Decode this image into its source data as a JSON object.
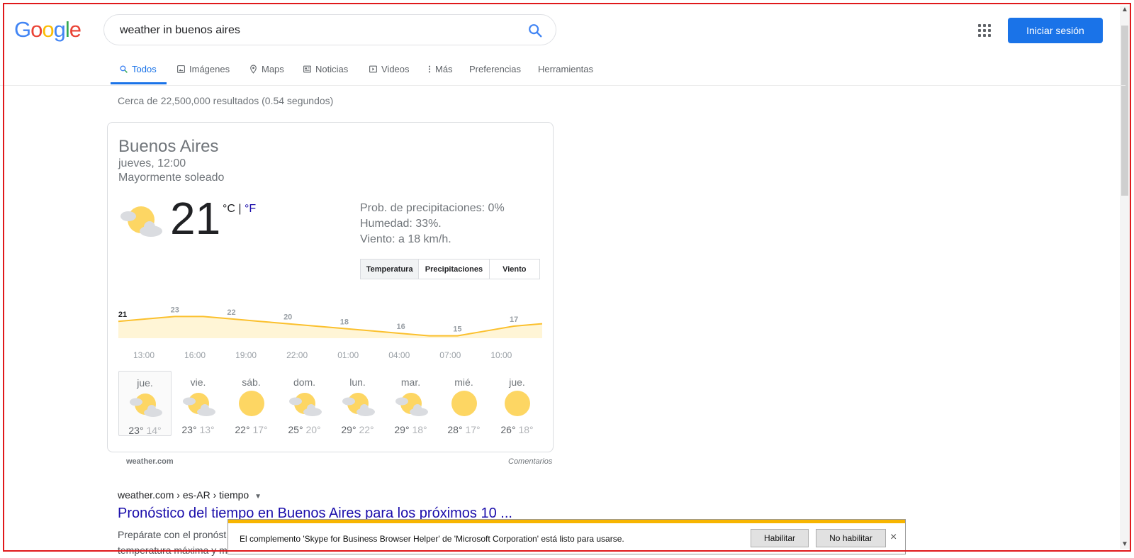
{
  "header": {
    "logo_letters": [
      {
        "ch": "G",
        "color": "#4285f4"
      },
      {
        "ch": "o",
        "color": "#ea4335"
      },
      {
        "ch": "o",
        "color": "#fbbc05"
      },
      {
        "ch": "g",
        "color": "#4285f4"
      },
      {
        "ch": "l",
        "color": "#34a853"
      },
      {
        "ch": "e",
        "color": "#ea4335"
      }
    ],
    "query": "weather in buenos aires",
    "signin_label": "Iniciar sesión"
  },
  "tabs": [
    {
      "label": "Todos",
      "icon": "search-icon",
      "active": true
    },
    {
      "label": "Imágenes",
      "icon": "image-icon"
    },
    {
      "label": "Maps",
      "icon": "map-pin-icon"
    },
    {
      "label": "Noticias",
      "icon": "news-icon"
    },
    {
      "label": "Videos",
      "icon": "video-icon"
    },
    {
      "label": "Más",
      "icon": "more-vert-icon"
    },
    {
      "label": "Preferencias"
    },
    {
      "label": "Herramientas"
    }
  ],
  "results_stats": "Cerca de 22,500,000 resultados (0.54 segundos)",
  "weather": {
    "location": "Buenos Aires",
    "datetime": "jueves, 12:00",
    "condition": "Mayormente soleado",
    "temperature": "21",
    "unit_c": "°C",
    "unit_sep": "|",
    "unit_f": "°F",
    "precip": "Prob. de precipitaciones: 0%",
    "humidity": "Humedad: 33%.",
    "wind": "Viento: a 18 km/h.",
    "segments": [
      "Temperatura",
      "Precipitaciones",
      "Viento"
    ],
    "source": "weather.com",
    "feedback": "Comentarios"
  },
  "chart_data": {
    "type": "area",
    "title": "",
    "x": [
      "12:00",
      "14:00",
      "16:00",
      "18:00",
      "20:00",
      "22:00",
      "00:00",
      "02:00",
      "04:00",
      "06:00",
      "08:00",
      "10:00",
      "12:00"
    ],
    "series": [
      {
        "values": [
          21,
          22,
          23,
          23,
          22,
          21,
          20,
          19,
          18,
          17,
          16,
          15,
          15,
          17,
          19,
          20
        ]
      }
    ],
    "point_labels": [
      {
        "label": "21",
        "index": 0
      },
      {
        "label": "23",
        "index": 2
      },
      {
        "label": "22",
        "index": 4
      },
      {
        "label": "20",
        "index": 6
      },
      {
        "label": "18",
        "index": 8
      },
      {
        "label": "16",
        "index": 10
      },
      {
        "label": "15",
        "index": 12
      },
      {
        "label": "17",
        "index": 14
      },
      {
        "label": "19",
        "index": 16
      }
    ],
    "tick_labels": [
      "13:00",
      "16:00",
      "19:00",
      "22:00",
      "01:00",
      "04:00",
      "07:00",
      "10:00"
    ],
    "ylim": [
      14,
      24
    ],
    "line_color": "#fbc02d",
    "fill_color": "#fff5d6"
  },
  "forecast": [
    {
      "day": "jue.",
      "hi": "23°",
      "lo": "14°",
      "icon": "partly-cloudy-icon",
      "selected": true
    },
    {
      "day": "vie.",
      "hi": "23°",
      "lo": "13°",
      "icon": "partly-cloudy-icon"
    },
    {
      "day": "sáb.",
      "hi": "22°",
      "lo": "17°",
      "icon": "sunny-icon"
    },
    {
      "day": "dom.",
      "hi": "25°",
      "lo": "20°",
      "icon": "partly-cloudy-icon"
    },
    {
      "day": "lun.",
      "hi": "29°",
      "lo": "22°",
      "icon": "partly-cloudy-icon"
    },
    {
      "day": "mar.",
      "hi": "29°",
      "lo": "18°",
      "icon": "partly-cloudy-icon"
    },
    {
      "day": "mié.",
      "hi": "28°",
      "lo": "17°",
      "icon": "sunny-icon"
    },
    {
      "day": "jue.",
      "hi": "26°",
      "lo": "18°",
      "icon": "sunny-icon"
    }
  ],
  "result": {
    "breadcrumb": "weather.com › es-AR › tiempo",
    "title": "Pronóstico del tiempo en Buenos Aires para los próximos 10 ...",
    "snippet_line1": "Prepárate con el pronóst",
    "snippet_line2": "temperatura máxima y m"
  },
  "notification": {
    "message": "El complemento 'Skype for Business Browser Helper' de 'Microsoft Corporation' está listo para usarse.",
    "enable": "Habilitar",
    "disable": "No habilitar",
    "close": "×"
  }
}
